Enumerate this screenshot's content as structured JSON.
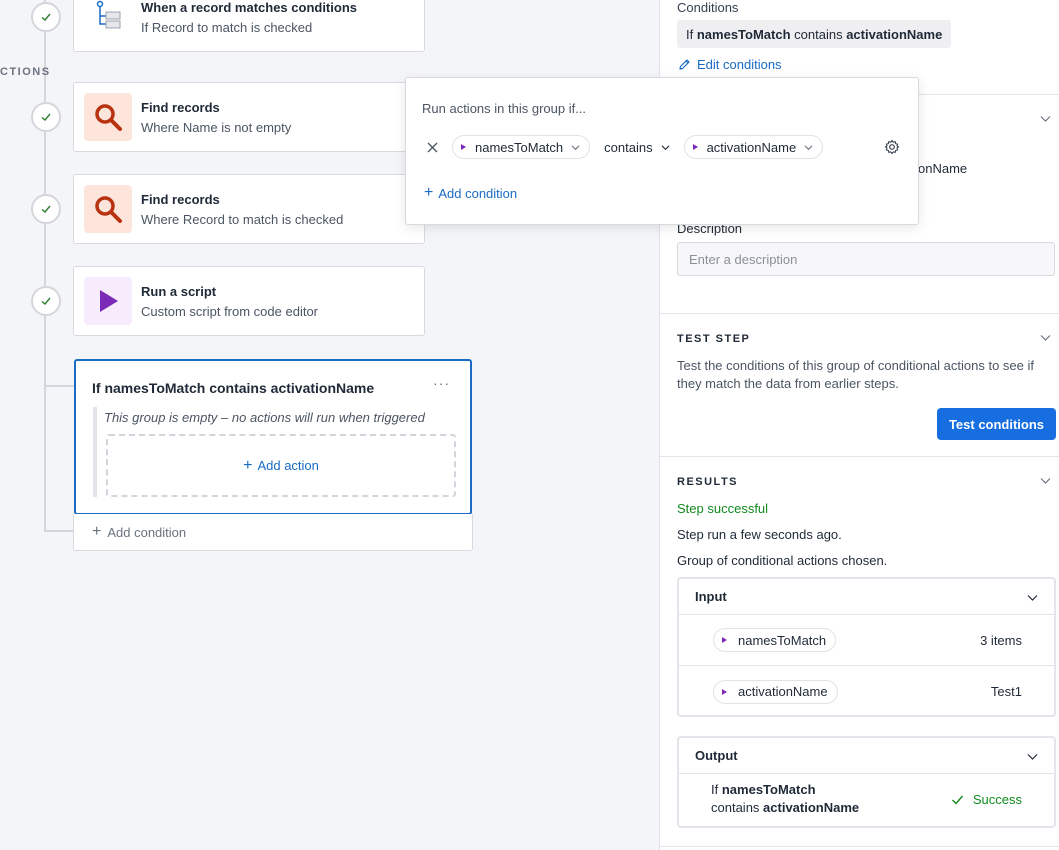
{
  "canvas": {
    "section_label": "CTIONS",
    "steps": [
      {
        "title": "When a record matches conditions",
        "subtitle": "If Record to match is checked"
      },
      {
        "title": "Find records",
        "subtitle": "Where Name is not empty"
      },
      {
        "title": "Find records",
        "subtitle": "Where Record to match is checked"
      },
      {
        "title": "Run a script",
        "subtitle": "Custom script from code editor"
      }
    ],
    "group": {
      "title": "If namesToMatch contains activationName",
      "more": "···",
      "empty_text": "This group is empty – no actions will run when triggered",
      "add_action": "Add action"
    },
    "add_condition": "Add condition"
  },
  "popover": {
    "title": "Run actions in this group if...",
    "field": "namesToMatch",
    "operator": "contains",
    "value": "activationName",
    "add_condition": "Add condition"
  },
  "panel": {
    "conditions_label": "Conditions",
    "condition_chip": {
      "if": "If",
      "field": "namesToMatch",
      "op": "contains",
      "value": "activationName"
    },
    "edit_conditions": "Edit conditions",
    "behind_text": "onName",
    "description_label": "Description",
    "description_placeholder": "Enter a description",
    "test_step": {
      "heading": "TEST STEP",
      "description": "Test the conditions of this group of conditional actions to see if they match the data from earlier steps.",
      "button": "Test conditions"
    },
    "results": {
      "heading": "RESULTS",
      "status": "Step successful",
      "time": "Step run a few seconds ago.",
      "chosen": "Group of conditional actions chosen.",
      "input": {
        "heading": "Input",
        "rows": [
          {
            "name": "namesToMatch",
            "value": "3 items"
          },
          {
            "name": "activationName",
            "value": "Test1"
          }
        ]
      },
      "output": {
        "heading": "Output",
        "line1_prefix": "If",
        "line1_field": "namesToMatch",
        "line2_op": "contains",
        "line2_value": "activationName",
        "status": "Success"
      }
    }
  },
  "colors": {
    "accent": "#1b6bc4",
    "button": "#166ee1",
    "success": "#118a1f",
    "find_icon": "#b8320f",
    "script_icon": "#7b2bb8"
  }
}
